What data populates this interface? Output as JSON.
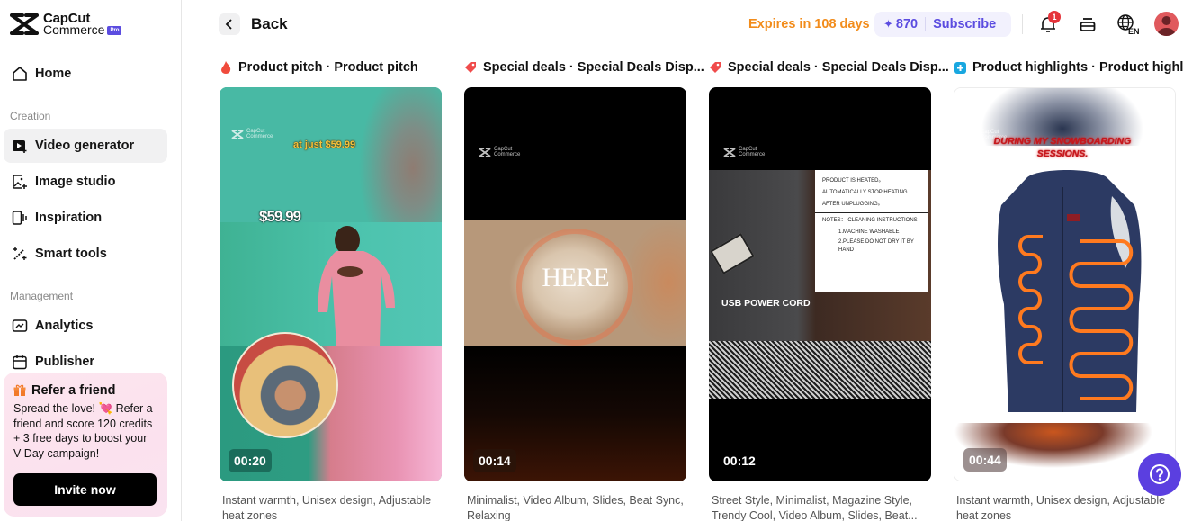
{
  "brand": {
    "name_line1": "CapCut",
    "name_line2": "Commerce",
    "badge": "Pro"
  },
  "sidebar": {
    "home": {
      "label": "Home",
      "icon": "home-icon"
    },
    "sections": [
      {
        "title": "Creation",
        "items": [
          {
            "label": "Video generator",
            "icon": "video-plus-icon",
            "active": true
          },
          {
            "label": "Image studio",
            "icon": "image-plus-icon",
            "active": false
          },
          {
            "label": "Inspiration",
            "icon": "inspiration-icon",
            "active": false
          },
          {
            "label": "Smart tools",
            "icon": "magic-wand-icon",
            "active": false
          }
        ]
      },
      {
        "title": "Management",
        "items": [
          {
            "label": "Analytics",
            "icon": "analytics-icon",
            "active": false
          },
          {
            "label": "Publisher",
            "icon": "calendar-icon",
            "active": false
          }
        ]
      }
    ],
    "refer": {
      "title": "Refer a friend",
      "body_pre": "Spread the love! ",
      "body_emoji": "💘",
      "body_post": " Refer a friend and score 120 credits + 3 free days to boost your V-Day campaign!",
      "button": "Invite now"
    }
  },
  "header": {
    "back_label": "Back",
    "expires": "Expires in 108 days",
    "credits": "870",
    "subscribe": "Subscribe",
    "notification_count": "1",
    "language": "EN"
  },
  "accent_colors": {
    "primary": "#5b4ce0",
    "warning": "#f28c1b",
    "badge": "#e5343b"
  },
  "cards": [
    {
      "icon": "flame-icon",
      "title": "Product pitch · Product pitch",
      "duration": "00:20",
      "overlay_texts": [
        "at just $59.99",
        "$59.99"
      ],
      "description": "Instant warmth, Unisex design, Adjustable heat zones"
    },
    {
      "icon": "tag-icon",
      "title": "Special deals · Special Deals Disp...",
      "duration": "00:14",
      "overlay_texts": [
        "HERE"
      ],
      "description": "Minimalist, Video Album, Slides, Beat Sync, Relaxing"
    },
    {
      "icon": "tag-icon",
      "title": "Special deals · Special Deals Disp...",
      "duration": "00:12",
      "overlay_texts": [
        "PRODUCT IS HEATED。",
        "AUTOMATICALLY STOP HEATING",
        "AFTER UNPLUGGING。",
        "NOTES： CLEANING INSTRUCTIONS",
        "1.MACHINE WASHABLE",
        "2.PLEASE DO NOT DRY IT BY HAND",
        "USB POWER CORD"
      ],
      "description": "Street Style, Minimalist, Magazine Style, Trendy Cool, Video Album, Slides, Beat..."
    },
    {
      "icon": "plus-square-icon",
      "title": "Product highlights · Product highl...",
      "duration": "00:44",
      "overlay_texts": [
        "DURING MY SNOWBOARDING SESSIONS."
      ],
      "description": "Instant warmth, Unisex design, Adjustable heat zones"
    }
  ],
  "watermark": {
    "line1": "CapCut",
    "line2": "Commerce"
  }
}
